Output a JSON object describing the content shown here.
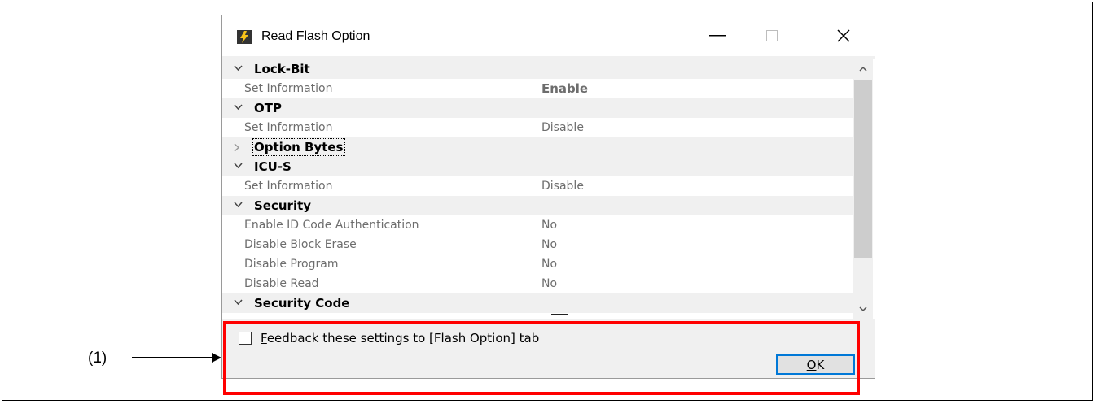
{
  "window": {
    "title": "Read Flash Option",
    "controls": {
      "minimize": "minimize-icon",
      "maximize": "maximize-icon",
      "close": "close-icon"
    }
  },
  "categories": [
    {
      "label": "Lock-Bit",
      "expanded": true,
      "properties": [
        {
          "name": "Set Information",
          "value": "Enable",
          "bold": true
        }
      ]
    },
    {
      "label": "OTP",
      "expanded": true,
      "properties": [
        {
          "name": "Set Information",
          "value": "Disable"
        }
      ]
    },
    {
      "label": "Option Bytes",
      "expanded": false,
      "focused": true,
      "properties": []
    },
    {
      "label": "ICU-S",
      "expanded": true,
      "properties": [
        {
          "name": "Set Information",
          "value": "Disable"
        }
      ]
    },
    {
      "label": "Security",
      "expanded": true,
      "properties": [
        {
          "name": "Enable ID Code Authentication",
          "value": "No"
        },
        {
          "name": "Disable Block Erase",
          "value": "No"
        },
        {
          "name": "Disable Program",
          "value": "No"
        },
        {
          "name": "Disable Read",
          "value": "No"
        }
      ]
    },
    {
      "label": "Security Code",
      "expanded": true,
      "properties": []
    }
  ],
  "feedback_checkbox": {
    "mnemonic": "F",
    "label_rest": "eedback these settings to [Flash Option] tab",
    "checked": false
  },
  "ok_button": {
    "mnemonic": "O",
    "label_rest": "K"
  },
  "annotation": {
    "label": "(1)",
    "highlight_color": "#ff0000"
  },
  "colors": {
    "accent": "#0078d7",
    "gray_text": "#6d6d6d"
  }
}
